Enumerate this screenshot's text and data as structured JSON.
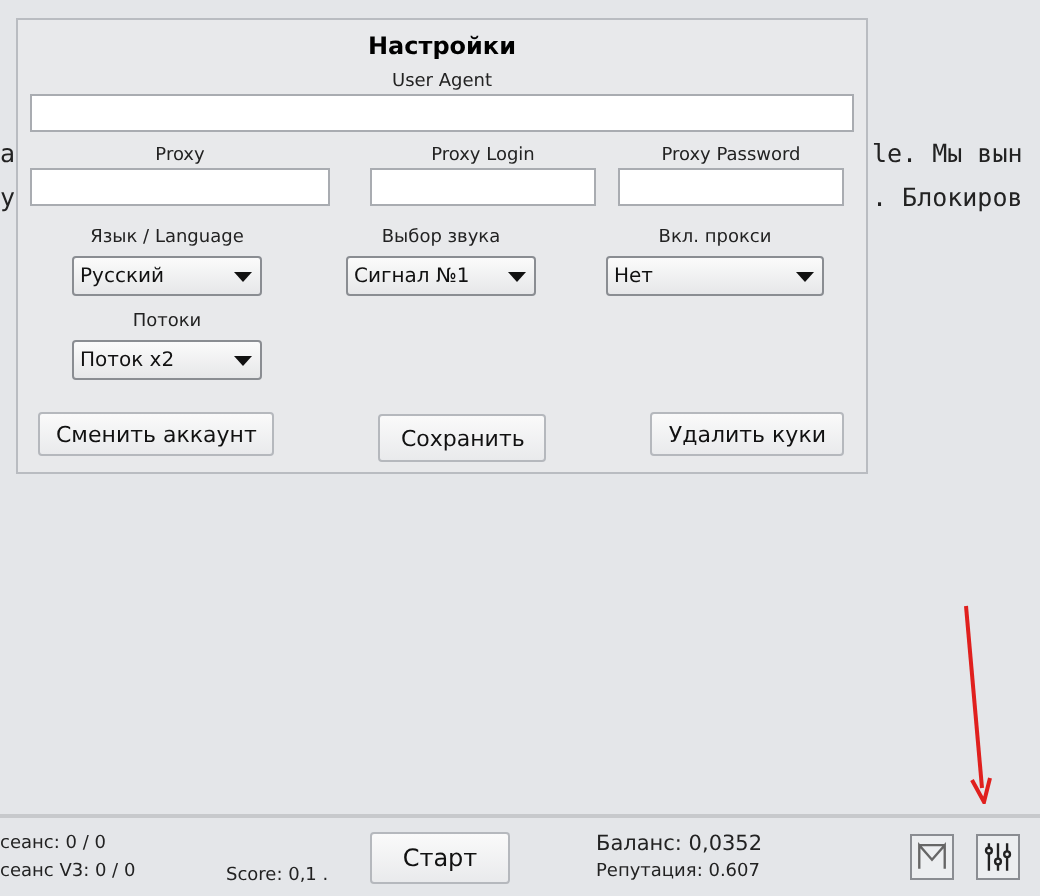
{
  "background_text": [
    {
      "left": "а",
      "right": "le. Мы вын"
    },
    {
      "left": "у",
      "right": ". Блокиров"
    }
  ],
  "dialog": {
    "title": "Настройки",
    "user_agent": {
      "label": "User Agent"
    },
    "proxy_fields": [
      {
        "label": "Proxy"
      },
      {
        "label": "Proxy Login"
      },
      {
        "label": "Proxy Password"
      }
    ],
    "dropdowns": [
      {
        "label": "Язык / Language",
        "value": "Русский"
      },
      {
        "label": "Выбор звука",
        "value": "Сигнал №1"
      },
      {
        "label": "Вкл. прокси",
        "value": "Нет"
      },
      {
        "label": "Потоки",
        "value": "Поток x2"
      }
    ],
    "buttons": [
      "Сменить аккаунт",
      "Сохранить",
      "Удалить куки"
    ]
  },
  "status_bar": {
    "session": "сеанс: 0 / 0",
    "session_v3": "сеанс V3: 0 / 0",
    "score": "Score: 0,1 .",
    "start_button": "Старт",
    "balance": "Баланс: 0,0352",
    "reputation": "Репутация: 0.607"
  }
}
